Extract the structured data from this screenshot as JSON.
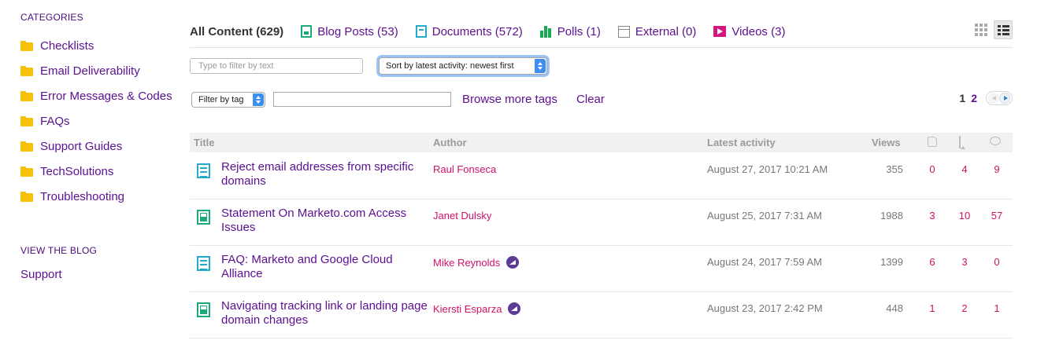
{
  "sidebar": {
    "categories_heading": "CATEGORIES",
    "categories": [
      {
        "label": "Checklists"
      },
      {
        "label": "Email Deliverability"
      },
      {
        "label": "Error Messages & Codes"
      },
      {
        "label": "FAQs"
      },
      {
        "label": "Support Guides"
      },
      {
        "label": "TechSolutions"
      },
      {
        "label": "Troubleshooting"
      }
    ],
    "blog_heading": "VIEW THE BLOG",
    "blog_link": "Support"
  },
  "tabs": {
    "all": "All Content (629)",
    "blog": "Blog Posts (53)",
    "documents": "Documents (572)",
    "polls": "Polls (1)",
    "external": "External (0)",
    "videos": "Videos (3)"
  },
  "view_toggle": {
    "grid_icon": "grid-view-icon",
    "list_icon": "list-view-icon",
    "active": "list"
  },
  "filters": {
    "text_placeholder": "Type to filter by text",
    "text_value": "",
    "sort_selected": "Sort by latest activity: newest first",
    "tag_selected": "Filter by tag",
    "tag_value": "",
    "browse_tags": "Browse more tags",
    "clear": "Clear"
  },
  "pagination": {
    "current": "1",
    "next_page": "2"
  },
  "table": {
    "headers": {
      "title": "Title",
      "author": "Author",
      "activity": "Latest activity",
      "views": "Views"
    },
    "rows": [
      {
        "type": "document",
        "title": "Reject email addresses from specific domains",
        "author": "Raul Fonseca",
        "badge": false,
        "date": "August 27, 2017 10:21 AM",
        "views": "355",
        "likes": "0",
        "bookmarks": "4",
        "comments": "9"
      },
      {
        "type": "blog",
        "title": "Statement On Marketo.com Access Issues",
        "author": "Janet Dulsky",
        "badge": false,
        "date": "August 25, 2017 7:31 AM",
        "views": "1988",
        "likes": "3",
        "bookmarks": "10",
        "comments": "57"
      },
      {
        "type": "document",
        "title": "FAQ: Marketo and Google Cloud Alliance",
        "author": "Mike Reynolds",
        "badge": true,
        "date": "August 24, 2017 7:59 AM",
        "views": "1399",
        "likes": "6",
        "bookmarks": "3",
        "comments": "0"
      },
      {
        "type": "blog",
        "title": "Navigating tracking link or landing page domain changes",
        "author": "Kiersti Esparza",
        "badge": true,
        "date": "August 23, 2017 2:42 PM",
        "views": "448",
        "likes": "1",
        "bookmarks": "2",
        "comments": "1"
      }
    ]
  },
  "colors": {
    "link": "#5b0f91",
    "author": "#d0106a",
    "folder": "#f4c20d",
    "blog": "#1aaa7a",
    "document": "#23a9c9",
    "video": "#d6167d"
  }
}
